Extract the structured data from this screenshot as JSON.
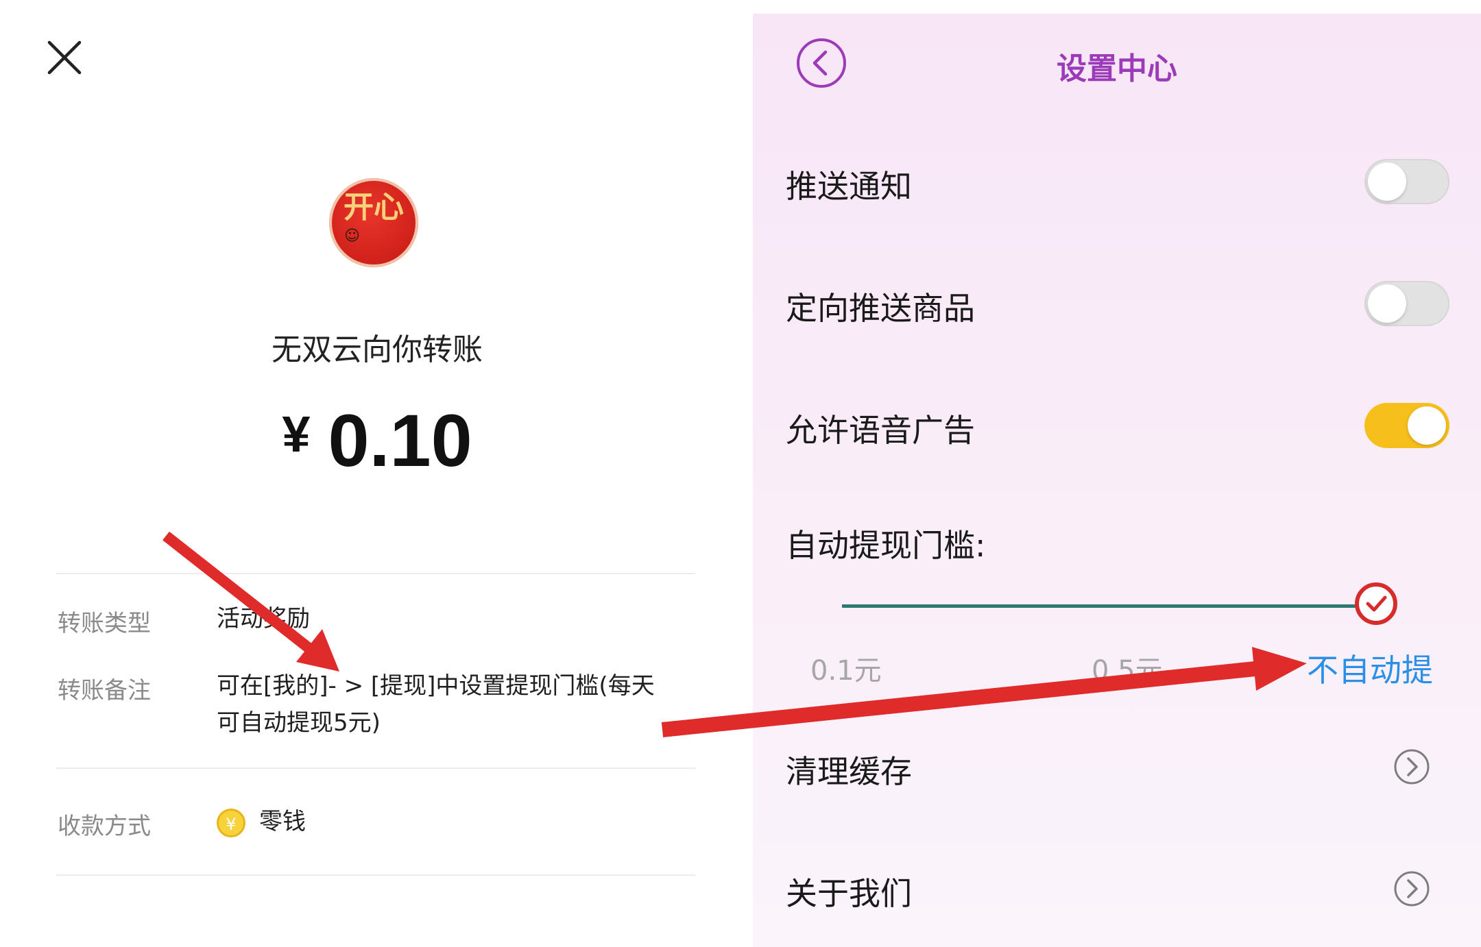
{
  "transfer": {
    "avatar_text": "开心",
    "title": "无双云向你转账",
    "currency": "¥",
    "amount": "0.10",
    "rows": [
      {
        "label": "转账类型",
        "value": "活动奖励"
      },
      {
        "label": "转账备注",
        "value": "可在[我的]- > [提现]中设置提现门槛(每天可自动提现5元)"
      },
      {
        "label": "收款方式",
        "value": "零钱"
      }
    ]
  },
  "settings": {
    "title": "设置中心",
    "items": [
      {
        "label": "推送通知",
        "toggle": "off"
      },
      {
        "label": "定向推送商品",
        "toggle": "off"
      },
      {
        "label": "允许语音广告",
        "toggle": "on"
      }
    ],
    "threshold": {
      "label": "自动提现门槛:",
      "options": [
        "0.1元",
        "0.5元",
        "不自动提"
      ],
      "selected": "不自动提"
    },
    "links": [
      {
        "label": "清理缓存"
      },
      {
        "label": "关于我们"
      }
    ]
  },
  "colors": {
    "settings_title": "#9b3bb8",
    "toggle_on": "#f6bf1c",
    "slider_track": "#2a7b73",
    "selected_option": "#2b8fe6",
    "annotation_arrow": "#e02b2b"
  },
  "icons": {
    "close": "close-icon",
    "back": "back-icon",
    "coin": "yuan-coin-icon",
    "chevron": "chevron-right-icon",
    "check": "check-icon"
  }
}
